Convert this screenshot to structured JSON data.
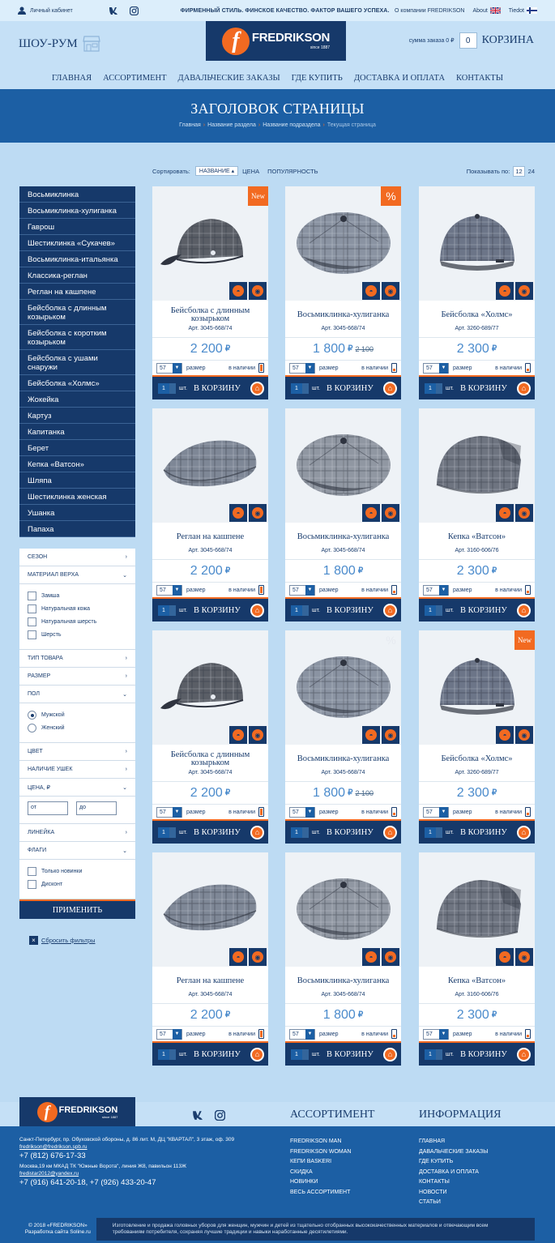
{
  "topbar": {
    "cabinet": "Личный кабинет",
    "slogan": "ФИРМЕННЫЙ СТИЛЬ. ФИНСКОЕ КАЧЕСТВО. ФАКТОР ВАШЕГО УСПЕХА.",
    "links": [
      "О компании FREDRIKSON",
      "About",
      "Tiedot"
    ]
  },
  "header": {
    "showroom": "ШОУ-РУМ",
    "logo_name": "FREDRIKSON",
    "logo_since": "since 1887",
    "cart_sum": "сумма заказа 0 ₽",
    "cart_count": "0",
    "cart_label": "КОРЗИНА"
  },
  "nav": [
    "ГЛАВНАЯ",
    "АССОРТИМЕНТ",
    "ДАВАЛЬЧЕСКИЕ ЗАКАЗЫ",
    "ГДЕ КУПИТЬ",
    "ДОСТАВКА И ОПЛАТА",
    "КОНТАКТЫ"
  ],
  "page": {
    "title": "ЗАГОЛОВОК СТРАНИЦЫ",
    "crumbs": [
      "Главная",
      "Название раздела",
      "Название подраздела",
      "Текущая страница"
    ]
  },
  "sort": {
    "label": "Сортировать:",
    "active": "НАЗВАНИЕ",
    "options": [
      "ЦЕНА",
      "ПОПУЛЯРНОСТЬ"
    ],
    "show_label": "Показывать по:",
    "pages": [
      "12",
      "24"
    ]
  },
  "categories": [
    "Восьмиклинка",
    "Восьмиклинка-хулиганка",
    "Гаврош",
    "Шестиклинка «Сукачев»",
    "Восьмиклинка-итальянка",
    "Классика-реглан",
    "Реглан на кашпене",
    "Бейсболка с длинным козырьком",
    "Бейсболка с коротким козырьком",
    "Бейсболка с ушами снаружи",
    "Бейсболка «Холмс»",
    "Жокейка",
    "Картуз",
    "Капитанка",
    "Берет",
    "Кепка «Ватсон»",
    "Шляпа",
    "Шестиклинка женская",
    "Ушанка",
    "Папаха"
  ],
  "filters": {
    "season": "СЕЗОН",
    "material": "МАТЕРИАЛ ВЕРХА",
    "materials": [
      "Замша",
      "Натуральная кожа",
      "Натуральная шерсть",
      "Шерсть"
    ],
    "type": "ТИП ТОВАРА",
    "size": "РАЗМЕР",
    "gender": "ПОЛ",
    "genders": [
      "Мужской",
      "Женский"
    ],
    "color": "ЦВЕТ",
    "ears": "НАЛИЧИЕ УШЕК",
    "price": "ЦЕНА, ₽",
    "price_from": "от",
    "price_to": "до",
    "line": "ЛИНЕЙКА",
    "flags": "ФЛАГИ",
    "flag_items": [
      "Только новинки",
      "Дисконт"
    ],
    "apply": "ПРИМЕНИТЬ",
    "reset": "Сбросить фильтры"
  },
  "card_labels": {
    "size": "размер",
    "stock": "в наличии",
    "pcs": "шт.",
    "to_cart": "В КОРЗИНУ",
    "currency": "₽"
  },
  "products": [
    {
      "name": "Бейсболка с длинным козырьком",
      "art": "Арт. 3045-668/74",
      "price": "2 200",
      "old": "",
      "badge": "New",
      "size": "57",
      "qty": "1",
      "stock": 0.85,
      "style": "baseball",
      "color": "#5a5e66"
    },
    {
      "name": "Восьмиклинка-хулиганка",
      "art": "Арт. 3045-668/74",
      "price": "1 800",
      "old": "2 100",
      "badge": "%",
      "size": "57",
      "qty": "1",
      "stock": 0.35,
      "style": "newsboy",
      "color": "#8a93a2"
    },
    {
      "name": "Бейсболка «Холмс»",
      "art": "Арт. 3260-689/77",
      "price": "2 300",
      "old": "",
      "badge": "",
      "size": "57",
      "qty": "1",
      "stock": 0.35,
      "style": "holmes",
      "color": "#6c7588"
    },
    {
      "name": "Реглан на кашпене",
      "art": "Арт. 3045-668/74",
      "price": "2 200",
      "old": "",
      "badge": "",
      "size": "57",
      "qty": "1",
      "stock": 0.85,
      "style": "flat",
      "color": "#7e8796"
    },
    {
      "name": "Восьмиклинка-хулиганка",
      "art": "Арт. 3045-668/74",
      "price": "1 800",
      "old": "",
      "badge": "",
      "size": "57",
      "qty": "1",
      "stock": 0.35,
      "style": "newsboy",
      "color": "#9097a2"
    },
    {
      "name": "Кепка «Ватсон»",
      "art": "Арт. 3160-606/76",
      "price": "2 300",
      "old": "",
      "badge": "",
      "size": "57",
      "qty": "1",
      "stock": 0.35,
      "style": "watson",
      "color": "#6e7480"
    },
    {
      "name": "Бейсболка с длинным козырьком",
      "art": "Арт. 3045-668/74",
      "price": "2 200",
      "old": "",
      "badge": "",
      "size": "57",
      "qty": "1",
      "stock": 0.85,
      "style": "baseball",
      "color": "#5a5e66"
    },
    {
      "name": "Восьмиклинка-хулиганка",
      "art": "Арт. 3045-668/74",
      "price": "1 800",
      "old": "2 100",
      "badge": "%g",
      "size": "57",
      "qty": "1",
      "stock": 0.35,
      "style": "newsboy",
      "color": "#8a93a2"
    },
    {
      "name": "Бейсболка «Холмс»",
      "art": "Арт. 3260-689/77",
      "price": "2 300",
      "old": "",
      "badge": "New",
      "size": "57",
      "qty": "1",
      "stock": 0.35,
      "style": "holmes",
      "color": "#6c7588"
    },
    {
      "name": "Реглан на кашпене",
      "art": "Арт. 3045-668/74",
      "price": "2 200",
      "old": "",
      "badge": "",
      "size": "57",
      "qty": "1",
      "stock": 0.85,
      "style": "flat",
      "color": "#7e8796"
    },
    {
      "name": "Восьмиклинка-хулиганка",
      "art": "Арт. 3045-668/74",
      "price": "1 800",
      "old": "",
      "badge": "",
      "size": "57",
      "qty": "1",
      "stock": 0.35,
      "style": "newsboy",
      "color": "#9097a2"
    },
    {
      "name": "Кепка «Ватсон»",
      "art": "Арт. 3160-606/76",
      "price": "2 300",
      "old": "",
      "badge": "",
      "size": "57",
      "qty": "1",
      "stock": 0.35,
      "style": "watson",
      "color": "#6e7480"
    }
  ],
  "footer": {
    "heading_assort": "АССОРТИМЕНТ",
    "heading_info": "ИНФОРМАЦИЯ",
    "address1": "Санкт-Петербург, пр. Обуховской обороны, д. 86 лит. М, ДЦ \"КВАРТАЛ\", 3 этаж, оф. 309",
    "email1": "fredrikson@fredrikson.spb.ru",
    "phone1": "+7 (812) 676-17-33",
    "address2": "Москва,19 км МКАД ТК \"Южные Ворота\", линия Ж8, павильон 113Ж",
    "email2": "fredistar2012@yandex.ru",
    "phone2": "+7 (916) 641-20-18, +7 (926) 433-20-47",
    "assort": [
      "FREDRIKSON MAN",
      "FREDRIKSON WOMAN",
      "КЕПИ BASKERI",
      "СКИДКА",
      "НОВИНКИ",
      "ВЕСЬ АССОРТИМЕНТ"
    ],
    "info": [
      "ГЛАВНАЯ",
      "ДАВАЛЬЧЕСКИЕ ЗАКАЗЫ",
      "ГДЕ КУПИТЬ",
      "ДОСТАВКА И ОПЛАТА",
      "КОНТАКТЫ",
      "НОВОСТИ",
      "СТАТЬИ"
    ],
    "copyright": "© 2018 «FREDRIKSON»",
    "dev": "Разработка сайта Soline.ru",
    "about": "Изготовление и продажа головных уборов для женщин, мужчин и детей из тщательно отобранных высококачественных материалов и отвечающим всем требованиям потребителя, сохраняя лучшие традиции и навыки наработанные десятилетиями."
  }
}
